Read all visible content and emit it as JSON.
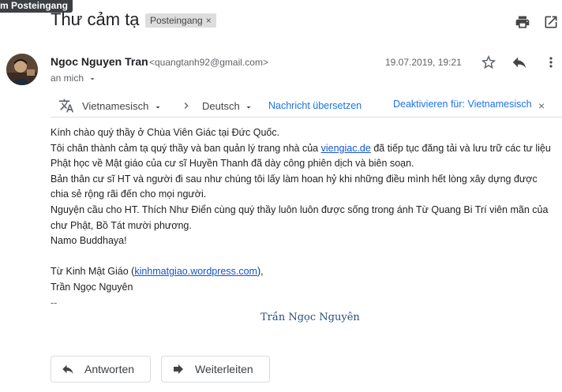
{
  "tooltip": "m Posteingang",
  "email": {
    "subject": "Thư cảm tạ",
    "label": "Posteingang",
    "label_close": "×",
    "sender_name": "Ngoc Nguyen Tran",
    "sender_email": "<quangtanh92@gmail.com>",
    "to": "an mich",
    "date": "19.07.2019, 19:21"
  },
  "translate_bar": {
    "source_lang": "Vietnamesisch",
    "target_lang": "Deutsch",
    "translate_link": "Nachricht übersetzen",
    "disable_link": "Deaktivieren für: Vietnamesisch",
    "close": "×"
  },
  "body": {
    "line1": "Kính chào quý thầy ở Chùa Viên Giác tại Đức Quốc.",
    "line2_before": "Tôi chân thành cảm tạ quý thầy và ban quản lý trang nhà của ",
    "line2_link": "viengiac.de",
    "line2_after": " đã tiếp tục đăng tải và lưu trữ các tư liệu Phật học về Mật giáo của cư sĩ Huyền Thanh đã dày công phiên dịch và biên soạn.",
    "line3": "Bản thân cư sĩ HT và người đi sau như chúng tôi lấy làm hoan hỷ khi những điều mình hết lòng xây dựng được chia sẻ rộng rãi đến cho mọi người.",
    "line4": "Nguyện cầu cho HT. Thích Như Điển cùng quý thầy luôn luôn được sống trong ánh Từ Quang Bi Trí viên mãn của chư Phật, Bồ Tát mười phương.",
    "line5": "Namo Buddhaya!",
    "sig_prefix": "Từ Kinh Mật Giáo (",
    "sig_link": "kinhmatgiao.wordpress.com",
    "sig_suffix": "),",
    "sig_name": "Trần Ngọc Nguyên",
    "sig_dash": "--",
    "sig_styled": "Trần Ngọc Nguyên"
  },
  "actions": {
    "reply": "Antworten",
    "forward": "Weiterleiten"
  },
  "icons": [
    "print-icon",
    "open-new-window-icon",
    "star-icon",
    "reply-icon",
    "more-vert-icon",
    "translate-icon",
    "chevron-down-icon",
    "chevron-right-icon",
    "close-icon",
    "forward-icon"
  ]
}
